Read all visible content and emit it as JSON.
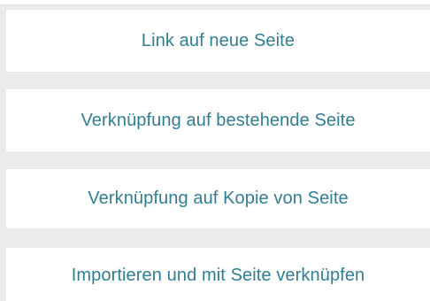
{
  "colors": {
    "accent_text": "#2f7f94",
    "separator": "#ebebeb",
    "option_background": "#ffffff"
  },
  "options": [
    {
      "label": "Link auf neue Seite"
    },
    {
      "label": "Verknüpfung auf bestehende Seite"
    },
    {
      "label": "Verknüpfung auf Kopie von Seite"
    },
    {
      "label": "Importieren und mit Seite verknüpfen"
    }
  ]
}
